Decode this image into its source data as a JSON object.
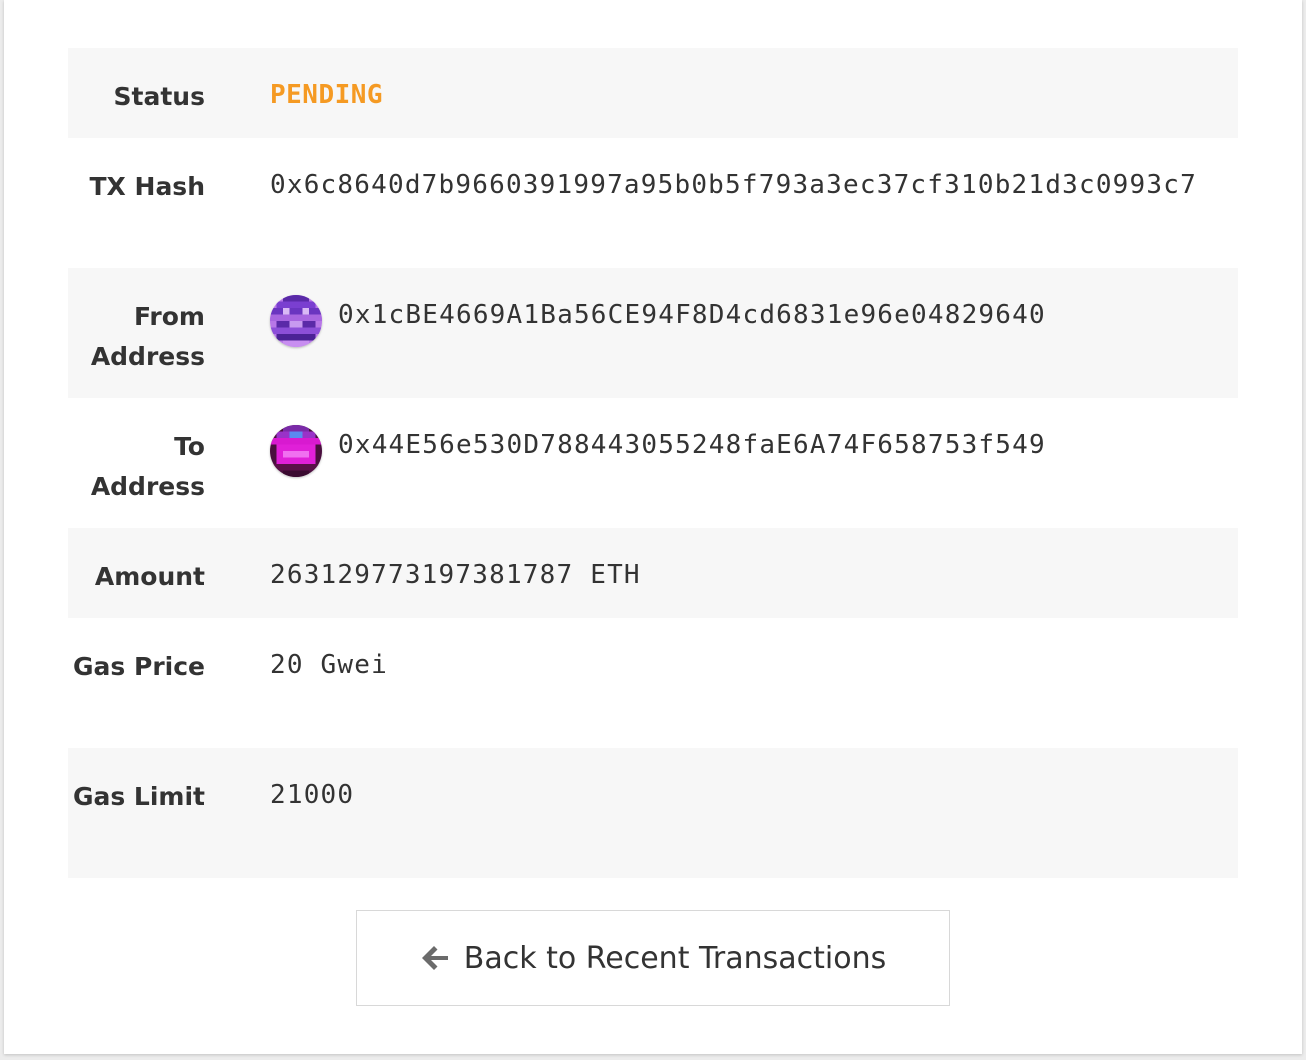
{
  "transaction": {
    "status_label": "Status",
    "status_value": "PENDING",
    "status_color": "#f59a23",
    "tx_hash_label": "TX Hash",
    "tx_hash_value": "0x6c8640d7b9660391997a95b0b5f793a3ec37cf310b21d3c0993c7",
    "from_label": "From Address",
    "from_value": "0x1cBE4669A1Ba56CE94F8D4cd6831e96e04829640",
    "from_avatar_icon": "identicon-purple",
    "to_label": "To Address",
    "to_value": "0x44E56e530D788443055248faE6A74F658753f549",
    "to_avatar_icon": "identicon-magenta",
    "amount_label": "Amount",
    "amount_value": "263129773197381787 ETH",
    "gas_price_label": "Gas Price",
    "gas_price_value": "20 Gwei",
    "gas_limit_label": "Gas Limit",
    "gas_limit_value": "21000"
  },
  "back_button": {
    "label": "Back to Recent Transactions",
    "icon": "arrow-left-icon"
  }
}
